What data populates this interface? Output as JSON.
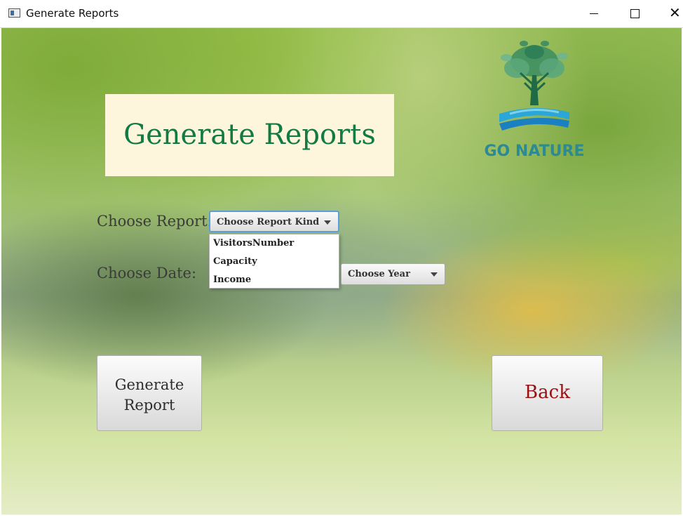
{
  "window": {
    "title": "Generate Reports",
    "controls": {
      "minimize": "minimize",
      "maximize": "maximize",
      "close": "close"
    }
  },
  "header": {
    "title": "Generate Reports"
  },
  "logo": {
    "text": "GO NATURE"
  },
  "form": {
    "report_label": "Choose Report:",
    "report_combo": {
      "value": "Choose Report Kind",
      "options": [
        "VisitorsNumber",
        "Capacity",
        "Income"
      ]
    },
    "date_label": "Choose Date:",
    "year_combo": {
      "value": "Choose Year"
    }
  },
  "buttons": {
    "generate_line1": "Generate",
    "generate_line2": "Report",
    "back": "Back"
  },
  "colors": {
    "title_green": "#127a43",
    "back_red": "#9a0f12",
    "header_bg": "#fdf6dc",
    "focus_blue": "#5b9fd8"
  }
}
